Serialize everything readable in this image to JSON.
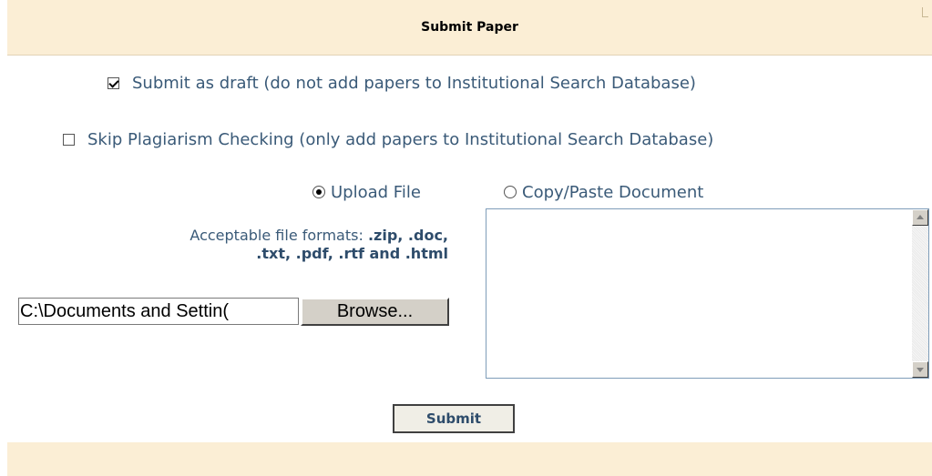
{
  "panel": {
    "title": "Submit Paper"
  },
  "options": {
    "draft": {
      "label": "Submit as draft (do not add papers to Institutional Search Database)",
      "checked": true
    },
    "skip_plagiarism": {
      "label": "Skip Plagiarism Checking (only add papers to Institutional Search Database)",
      "checked": false
    }
  },
  "upload_mode": {
    "upload_file_label": "Upload File",
    "copy_paste_label": "Copy/Paste Document",
    "selected": "Upload File"
  },
  "formats": {
    "prefix": "Acceptable file formats: ",
    "list_part1": ".zip, .doc,",
    "list_part2": ".txt, .pdf, .rtf and .html"
  },
  "file": {
    "value": "C:\\Documents and Settin(",
    "browse_label": "Browse..."
  },
  "document_text": "",
  "submit_label": "Submit",
  "icons": [
    "checkbox-checked-icon",
    "checkbox-unchecked-icon",
    "radio-selected-icon",
    "radio-unselected-icon",
    "scroll-up-arrow-icon",
    "scroll-down-arrow-icon"
  ],
  "colors": {
    "header_bg": "#fbeed5",
    "text": "#3a5a78",
    "accent_text": "#2e4c6b"
  }
}
